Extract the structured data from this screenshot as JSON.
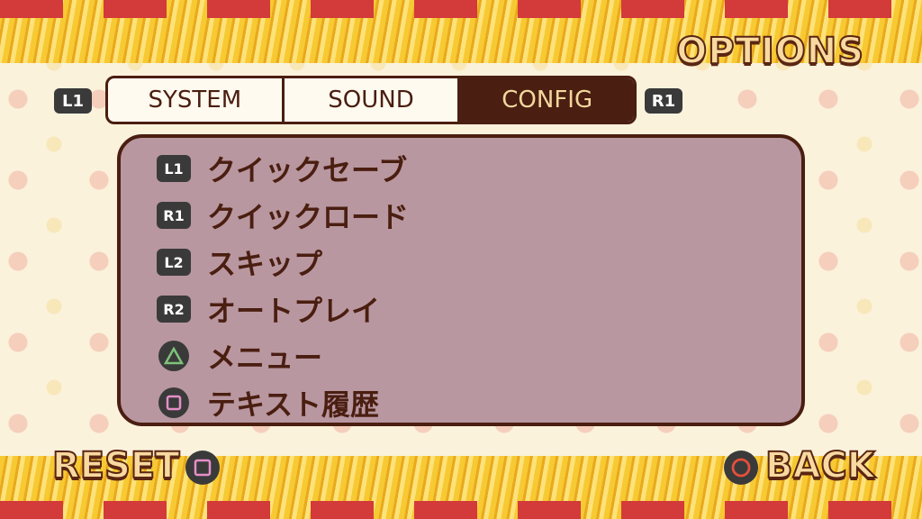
{
  "screen": {
    "title": "OPTIONS"
  },
  "tabs": {
    "prev_shoulder": "L1",
    "next_shoulder": "R1",
    "items": [
      {
        "label": "SYSTEM",
        "active": false
      },
      {
        "label": "SOUND",
        "active": false
      },
      {
        "label": "CONFIG",
        "active": true
      }
    ]
  },
  "config": {
    "items": [
      {
        "key": "L1",
        "icon": "l1-button-icon",
        "label": "クイックセーブ"
      },
      {
        "key": "R1",
        "icon": "r1-button-icon",
        "label": "クイックロード"
      },
      {
        "key": "L2",
        "icon": "l2-button-icon",
        "label": "スキップ"
      },
      {
        "key": "R2",
        "icon": "r2-button-icon",
        "label": "オートプレイ"
      },
      {
        "key": "",
        "icon": "triangle-button-icon",
        "label": "メニュー"
      },
      {
        "key": "",
        "icon": "square-button-icon",
        "label": "テキスト履歴"
      }
    ]
  },
  "footer": {
    "reset_label": "RESET",
    "reset_icon": "square-button-icon",
    "back_label": "BACK",
    "back_icon": "circle-button-icon"
  },
  "colors": {
    "accent_dark": "#4a1e10",
    "panel": "#b897a0",
    "title_fill": "#f8d9a0",
    "triangle": "#7ec27a",
    "square": "#e58fc7",
    "circle": "#e5503a"
  }
}
